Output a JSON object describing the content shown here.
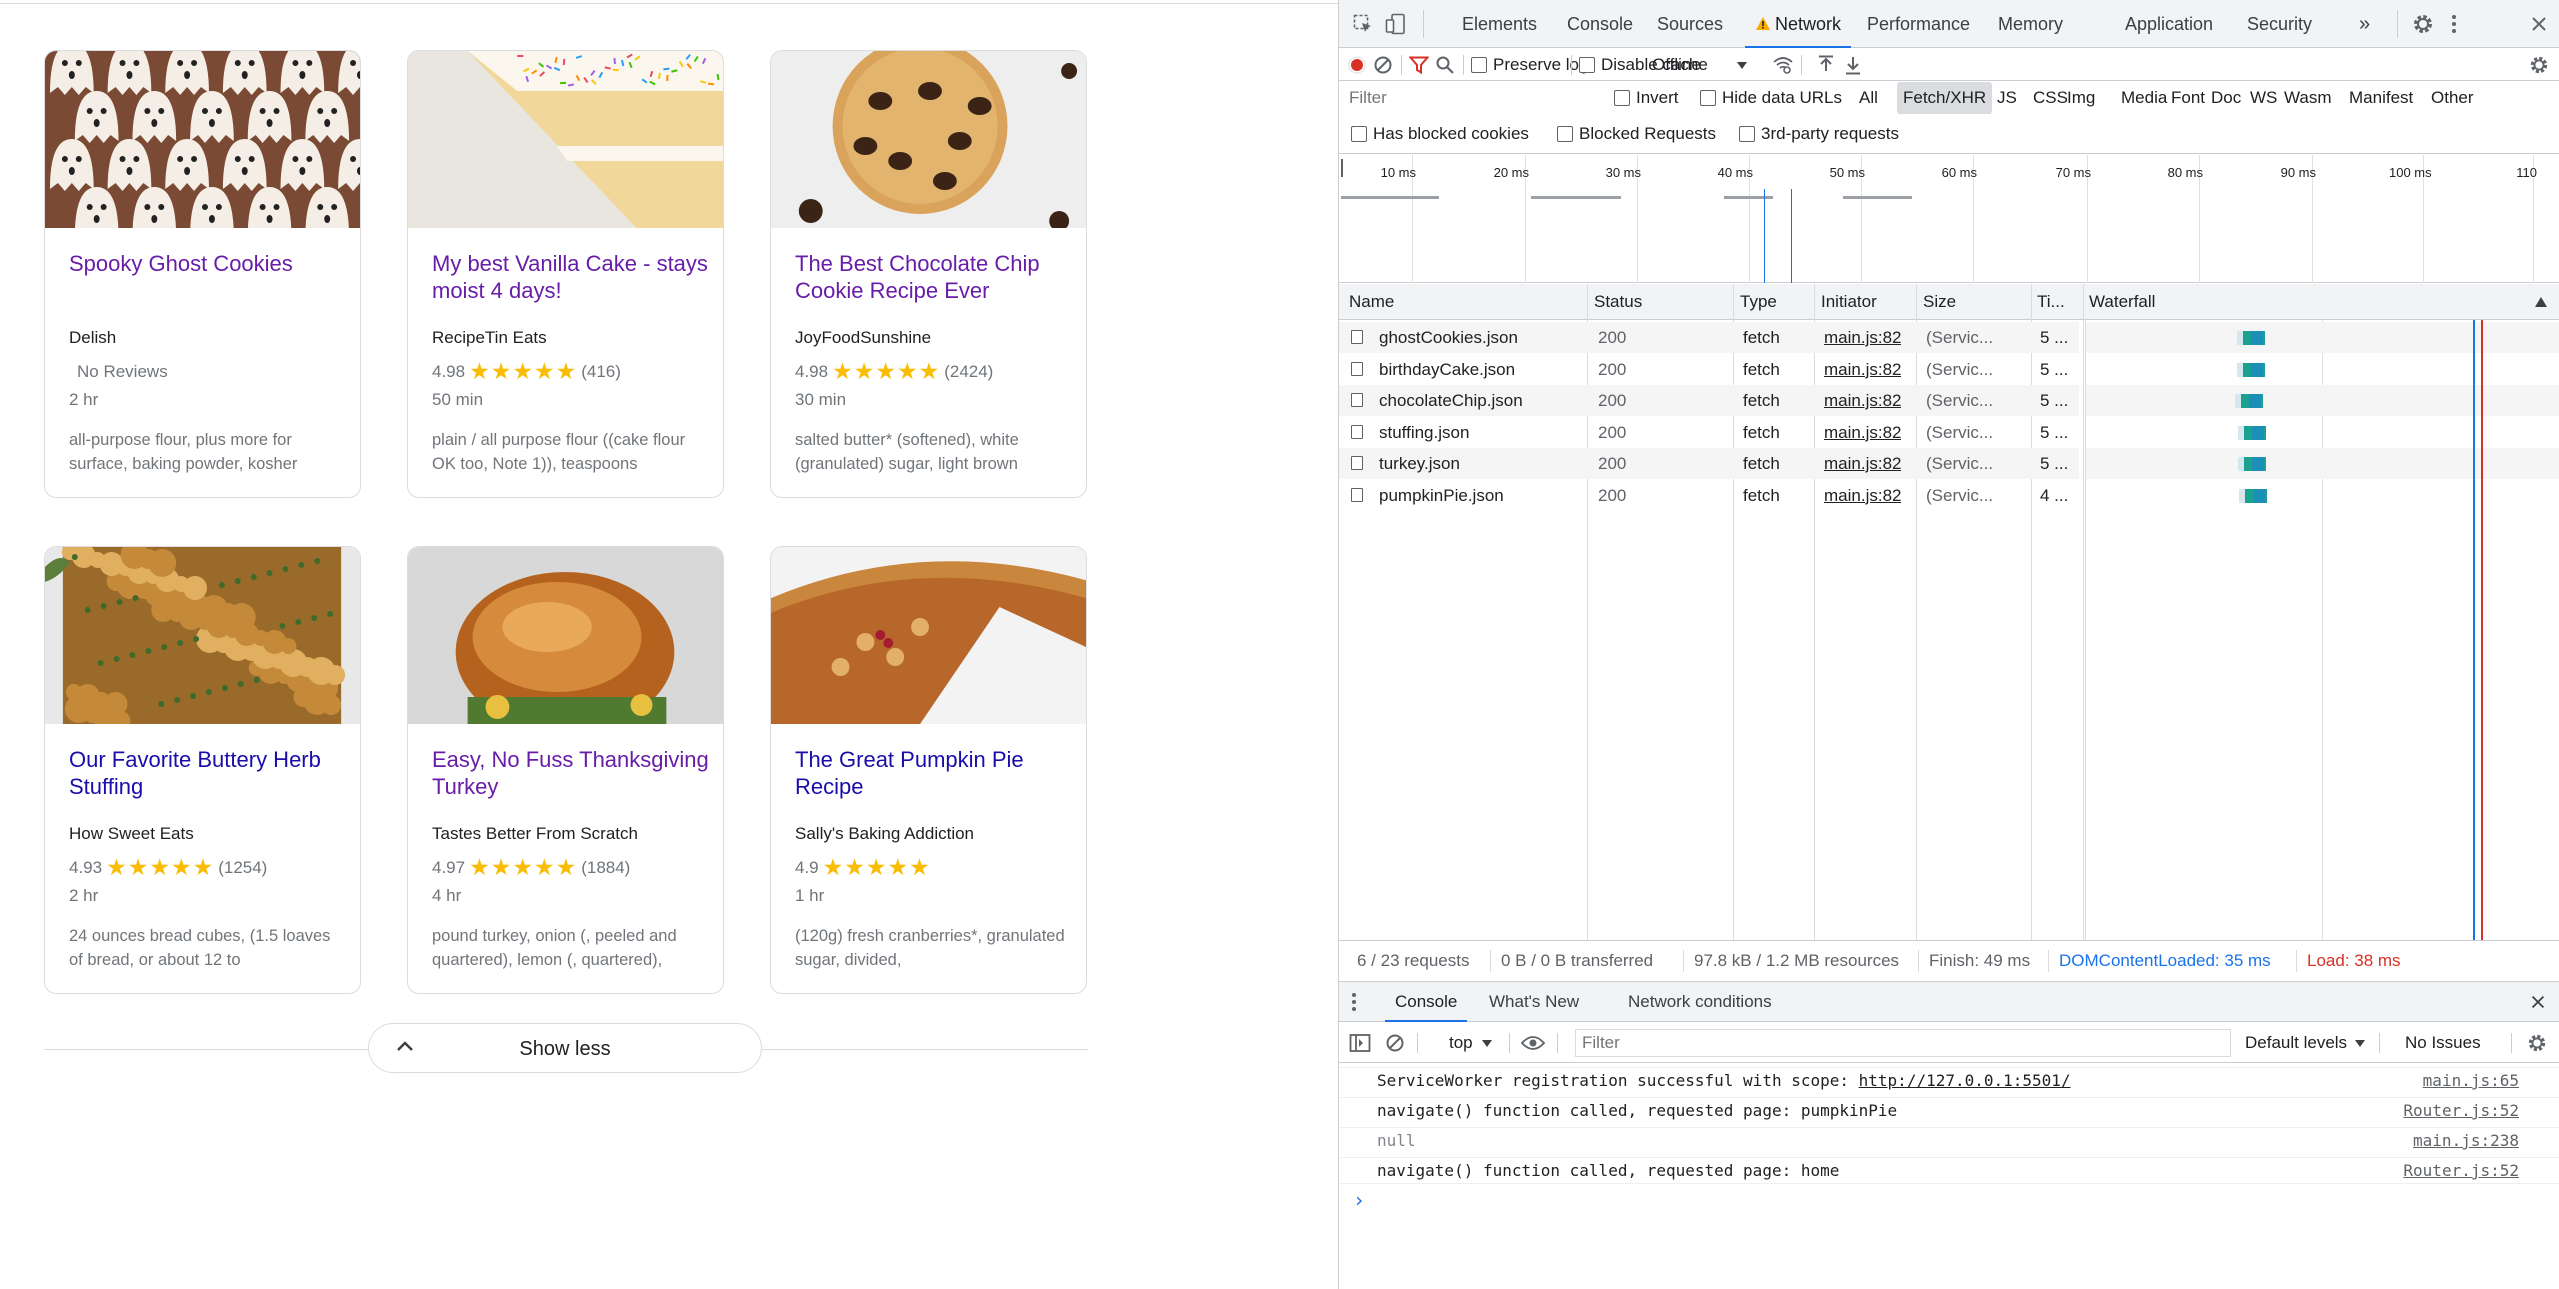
{
  "recipes": [
    {
      "title": "Spooky Ghost Cookies",
      "source": "Delish",
      "rating": "",
      "stars": "",
      "reviews": "No Reviews",
      "time": "2 hr",
      "ingredients": "all-purpose flour, plus more for surface, baking powder, kosher",
      "visited": true
    },
    {
      "title": "My best Vanilla Cake - stays moist 4 days!",
      "source": "RecipeTin Eats",
      "rating": "4.98",
      "stars": "★★★★★",
      "reviews": "(416)",
      "time": "50 min",
      "ingredients": "plain / all purpose flour ((cake flour OK too, Note 1)), teaspoons",
      "visited": true
    },
    {
      "title": "The Best Chocolate Chip Cookie Recipe Ever",
      "source": "JoyFoodSunshine",
      "rating": "4.98",
      "stars": "★★★★★",
      "reviews": "(2424)",
      "time": "30 min",
      "ingredients": "salted butter* (softened), white (granulated) sugar, light brown",
      "visited": true
    },
    {
      "title": "Our Favorite Buttery Herb Stuffing",
      "source": "How Sweet Eats",
      "rating": "4.93",
      "stars": "★★★★★",
      "reviews": "(1254)",
      "time": "2 hr",
      "ingredients": "24 ounces bread cubes, (1.5 loaves of bread, or about 12 to",
      "visited": false
    },
    {
      "title": "Easy, No Fuss Thanksgiving Turkey",
      "source": "Tastes Better From Scratch",
      "rating": "4.97",
      "stars": "★★★★★",
      "reviews": "(1884)",
      "time": "4 hr",
      "ingredients": "pound turkey, onion (, peeled and quartered), lemon (, quartered),",
      "visited": true
    },
    {
      "title": "The Great Pumpkin Pie Recipe",
      "source": "Sally's Baking Addiction",
      "rating": "4.9",
      "stars": "★★★★★",
      "reviews": "",
      "time": "1 hr",
      "ingredients": "(120g) fresh cranberries*, granulated sugar, divided,",
      "visited": false
    }
  ],
  "show_less_label": "Show less",
  "devtools": {
    "tabs": [
      "Elements",
      "Console",
      "Sources",
      "Network",
      "Performance",
      "Memory",
      "Application",
      "Security"
    ],
    "active_tab": "Network",
    "more_tabs": "»",
    "toolbar": {
      "preserve_log": "Preserve log",
      "disable_cache": "Disable cache",
      "throttling": "Offline"
    },
    "filter_placeholder": "Filter",
    "invert": "Invert",
    "hide_data_urls": "Hide data URLs",
    "types": [
      "All",
      "Fetch/XHR",
      "JS",
      "CSS",
      "Img",
      "Media",
      "Font",
      "Doc",
      "WS",
      "Wasm",
      "Manifest",
      "Other"
    ],
    "selected_type": "Fetch/XHR",
    "has_blocked_cookies": "Has blocked cookies",
    "blocked_requests": "Blocked Requests",
    "third_party": "3rd-party requests",
    "timeline_ticks": [
      "10 ms",
      "20 ms",
      "30 ms",
      "40 ms",
      "50 ms",
      "60 ms",
      "70 ms",
      "80 ms",
      "90 ms",
      "100 ms",
      "110"
    ],
    "columns": [
      "Name",
      "Status",
      "Type",
      "Initiator",
      "Size",
      "Ti...",
      "Waterfall"
    ],
    "requests": [
      {
        "name": "ghostCookies.json",
        "status": "200",
        "type": "fetch",
        "initiator": "main.js:82",
        "size": "(Servic...",
        "time": "5 ..."
      },
      {
        "name": "birthdayCake.json",
        "status": "200",
        "type": "fetch",
        "initiator": "main.js:82",
        "size": "(Servic...",
        "time": "5 ..."
      },
      {
        "name": "chocolateChip.json",
        "status": "200",
        "type": "fetch",
        "initiator": "main.js:82",
        "size": "(Servic...",
        "time": "5 ..."
      },
      {
        "name": "stuffing.json",
        "status": "200",
        "type": "fetch",
        "initiator": "main.js:82",
        "size": "(Servic...",
        "time": "5 ..."
      },
      {
        "name": "turkey.json",
        "status": "200",
        "type": "fetch",
        "initiator": "main.js:82",
        "size": "(Servic...",
        "time": "5 ..."
      },
      {
        "name": "pumpkinPie.json",
        "status": "200",
        "type": "fetch",
        "initiator": "main.js:82",
        "size": "(Servic...",
        "time": "4 ..."
      }
    ],
    "summary": {
      "requests": "6 / 23 requests",
      "transferred": "0 B / 0 B transferred",
      "resources": "97.8 kB / 1.2 MB resources",
      "finish": "Finish: 49 ms",
      "dcl": "DOMContentLoaded: 35 ms",
      "load": "Load: 38 ms"
    },
    "drawer_tabs": [
      "Console",
      "What's New",
      "Network conditions"
    ],
    "console": {
      "context": "top",
      "filter_placeholder": "Filter",
      "levels": "Default levels",
      "issues": "No Issues",
      "messages": [
        {
          "text": "ServiceWorker registration successful with scope: ",
          "link": "http://127.0.0.1:5501/",
          "source": "main.js:65"
        },
        {
          "text": "navigate() function called, requested page: pumpkinPie",
          "link": "",
          "source": "Router.js:52"
        },
        {
          "text": "null",
          "link": "",
          "source": "main.js:238"
        },
        {
          "text": "navigate() function called, requested page: home",
          "link": "",
          "source": "Router.js:52"
        }
      ],
      "prompt": "›"
    },
    "colors": {
      "accent": "#1a73e8",
      "dcl": "#1a73e8",
      "load": "#d93025",
      "record": "#d93025"
    }
  }
}
